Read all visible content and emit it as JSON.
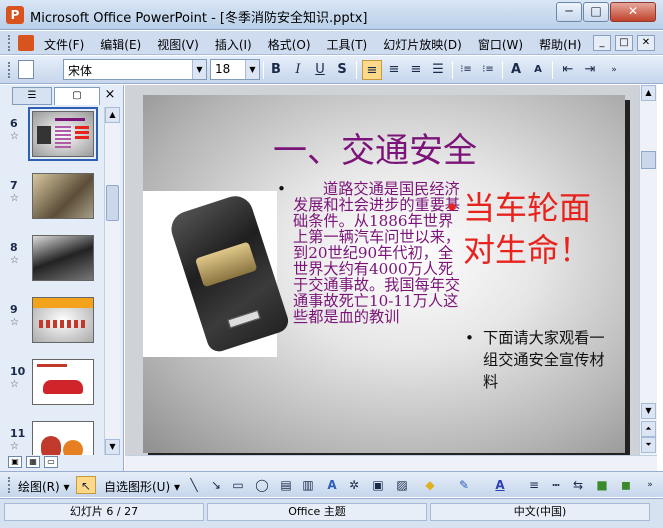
{
  "window": {
    "app_icon": "P",
    "title": "Microsoft Office PowerPoint - [冬季消防安全知识.pptx]",
    "min": "─",
    "max": "□",
    "close": "✕"
  },
  "menu": {
    "items": [
      "文件(F)",
      "编辑(E)",
      "视图(V)",
      "插入(I)",
      "格式(O)",
      "工具(T)",
      "幻灯片放映(D)",
      "窗口(W)",
      "帮助(H)"
    ],
    "mdi_min": "_",
    "mdi_max": "□",
    "mdi_close": "✕"
  },
  "toolbar": {
    "font": "宋体",
    "size": "18",
    "bold": "B",
    "italic": "I",
    "underline": "U",
    "shadow": "S",
    "align_left": "≡",
    "align_center": "≡",
    "align_right": "≡",
    "numbering": "⁝≡",
    "bullets": "⁝≡",
    "grow_font": "A",
    "shrink_font": "A",
    "decrease_indent": "⇤",
    "increase_indent": "⇥"
  },
  "panel": {
    "tab_outline": "☰",
    "tab_slides": "▢",
    "close": "×",
    "slides": [
      {
        "num": "6",
        "selected": true
      },
      {
        "num": "7",
        "selected": false
      },
      {
        "num": "8",
        "selected": false
      },
      {
        "num": "9",
        "selected": false
      },
      {
        "num": "10",
        "selected": false
      },
      {
        "num": "11",
        "selected": false
      }
    ],
    "star": "☆"
  },
  "slide": {
    "title": "一、交通安全",
    "bullet1": "道路交通是国民经济发展和社会进步的重要基础条件。从1886年世界上第一辆汽车问世以来，到20世纪90年代初，全世界大约有4000万人死于交通事故。我国每年交通事故死亡10-11万人这些都是血的教训",
    "red_text": "当车轮面对生命！",
    "bullet2": "下面请大家观看一组交通安全宣传材料"
  },
  "drawbar": {
    "draw_label": "绘图(R) ▾",
    "autoshape_label": "自选图形(U) ▾"
  },
  "status": {
    "slide": "幻灯片 6 / 27",
    "theme": "Office 主题",
    "language": "中文(中国)"
  },
  "colors": {
    "title_purple": "#7b1478",
    "red_text": "#e8231e"
  }
}
